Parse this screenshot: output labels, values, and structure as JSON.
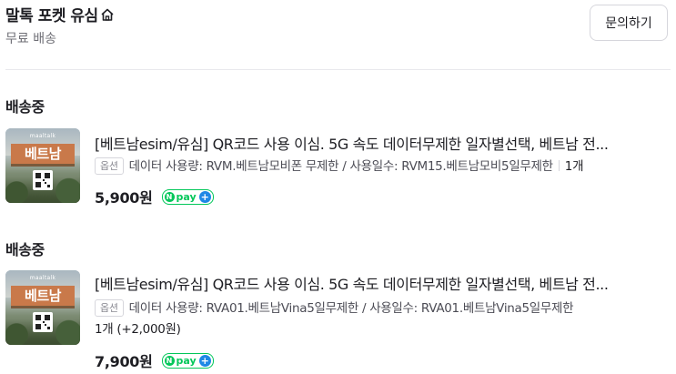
{
  "header": {
    "store_title": "말톡 포켓 유심",
    "home_icon": "home-icon",
    "shipping_info": "무료 배송",
    "inquiry_label": "문의하기"
  },
  "orders": [
    {
      "status": "배송중",
      "thumbnail": {
        "brand": "maaltalk",
        "country": "베트남"
      },
      "product_name": "[베트남esim/유심] QR코드 사용 이심. 5G 속도 데이터무제한 일자별선택, 베트남 전...",
      "option_badge": "옵션",
      "option_text": "데이터 사용량: RVM.베트남모비폰 무제한 / 사용일수: RVM15.베트남모비5일무제한",
      "quantity": "1개",
      "price": "5,900원",
      "npay_label": "pay"
    },
    {
      "status": "배송중",
      "thumbnail": {
        "brand": "maaltalk",
        "country": "베트남"
      },
      "product_name": "[베트남esim/유심] QR코드 사용 이심. 5G 속도 데이터무제한 일자별선택, 베트남 전...",
      "option_badge": "옵션",
      "option_text": "데이터 사용량: RVA01.베트남Vina5일무제한 / 사용일수: RVA01.베트남Vina5일무제한",
      "quantity": "1개 (+2,000원)",
      "price": "7,900원",
      "npay_label": "pay"
    }
  ]
}
